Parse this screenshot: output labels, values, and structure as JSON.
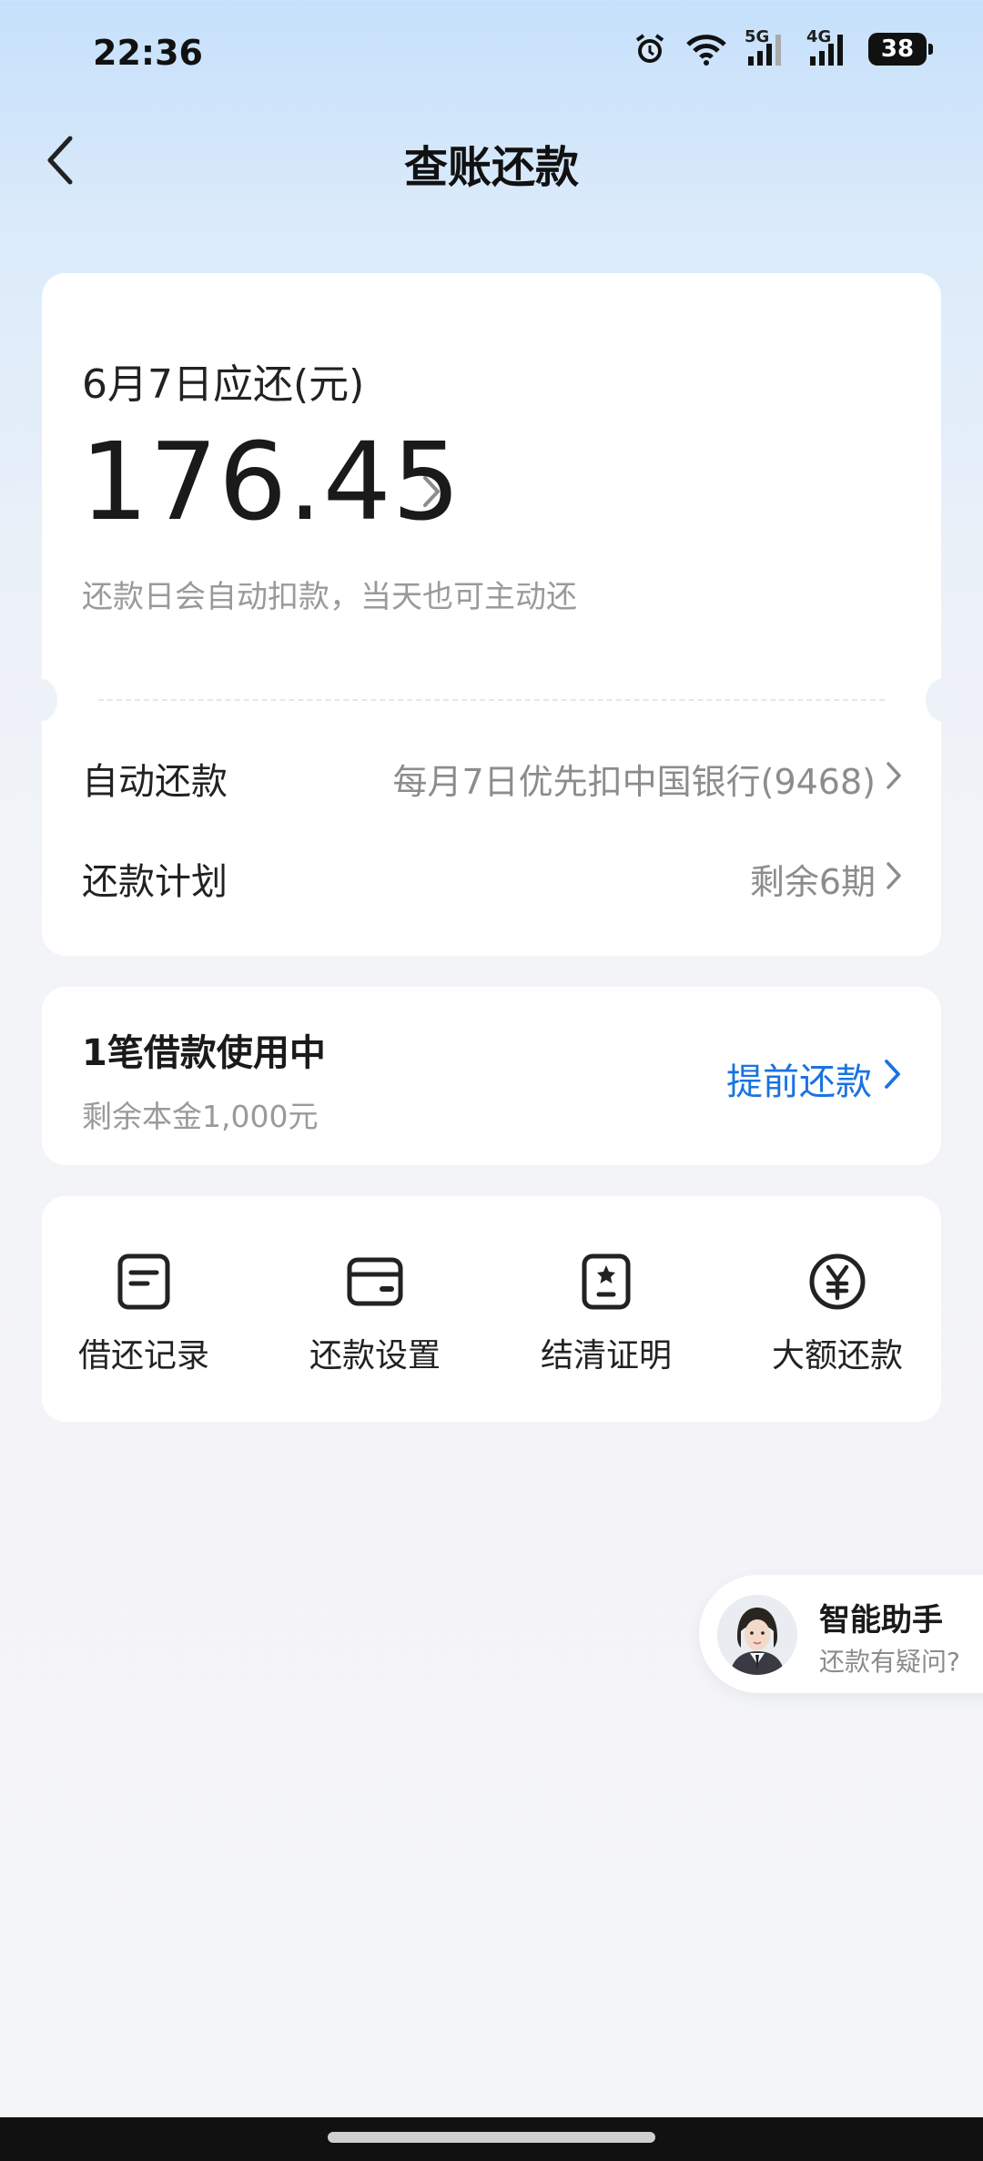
{
  "status_bar": {
    "time": "22:36",
    "network_5g": "5G",
    "network_4g": "4G",
    "battery": "38",
    "icons": [
      "alarm-icon",
      "wifi-icon",
      "signal-5g-icon",
      "signal-4g-icon",
      "battery-icon"
    ]
  },
  "header": {
    "title": "查账还款",
    "back_icon": "chevron-left-icon"
  },
  "due": {
    "label": "6月7日应还(元)",
    "amount": "176.45",
    "hint": "还款日会自动扣款，当天也可主动还"
  },
  "auto_repay": {
    "label": "自动还款",
    "value": "每月7日优先扣中国银行(9468)"
  },
  "plan": {
    "label": "还款计划",
    "value": "剩余6期"
  },
  "loan": {
    "title": "1笔借款使用中",
    "subtitle": "剩余本金1,000元",
    "prepay_label": "提前还款"
  },
  "actions": [
    {
      "label": "借还记录",
      "icon": "record-icon"
    },
    {
      "label": "还款设置",
      "icon": "card-icon"
    },
    {
      "label": "结清证明",
      "icon": "certificate-icon"
    },
    {
      "label": "大额还款",
      "icon": "yuan-icon"
    }
  ],
  "assistant": {
    "title": "智能助手",
    "subtitle": "还款有疑问?"
  },
  "colors": {
    "accent": "#1a73e0",
    "muted": "#9a9a9a",
    "background_top": "#c6e0fb",
    "background": "#f4f5f8"
  }
}
